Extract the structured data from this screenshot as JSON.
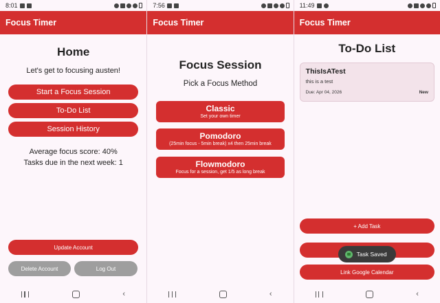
{
  "screens": [
    {
      "status_time": "8:01",
      "app_title": "Focus Timer",
      "heading": "Home",
      "greeting": "Let's get to focusing austen!",
      "buttons": {
        "start": "Start a Focus Session",
        "todo": "To-Do List",
        "history": "Session History"
      },
      "stats": {
        "focus_score": "Average focus score: 40%",
        "tasks_due": "Tasks due in the next week: 1"
      },
      "account": {
        "update": "Update Account",
        "delete": "Delete Account",
        "logout": "Log Out"
      }
    },
    {
      "status_time": "7:56",
      "app_title": "Focus Timer",
      "heading": "Focus Session",
      "subheading": "Pick a Focus Method",
      "methods": [
        {
          "title": "Classic",
          "desc": "Set your own timer"
        },
        {
          "title": "Pomodoro",
          "desc": "(25min focus - 5min break) x4 then 25min break"
        },
        {
          "title": "Flowmodoro",
          "desc": "Focus for a session, get 1/5 as long break"
        }
      ]
    },
    {
      "status_time": "11:49",
      "app_title": "Focus Timer",
      "heading": "To-Do List",
      "task": {
        "title": "ThisIsATest",
        "description": "this is a test",
        "due": "Due: Apr 04, 2026",
        "status": "New"
      },
      "buttons": {
        "add_task": "+ Add Task",
        "link_calendar": "Link Google Calendar"
      },
      "toast": "Task Saved"
    }
  ],
  "icons": [
    "status-bar-icons",
    "battery-icon",
    "nav-recents-icon",
    "nav-home-icon",
    "nav-back-icon",
    "toast-app-icon"
  ],
  "colors": {
    "primary": "#d42f2f",
    "background": "#fdf6fb",
    "secondary_button": "#9e9e9e",
    "toast": "#3a3a3a"
  }
}
